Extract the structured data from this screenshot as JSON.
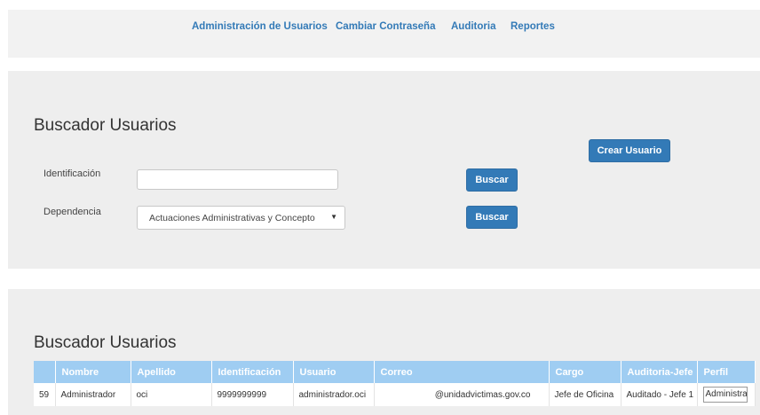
{
  "nav": {
    "items": [
      "Administración de Usuarios",
      "Cambiar Contraseña",
      "Auditoria",
      "Reportes"
    ]
  },
  "search_panel": {
    "title": "Buscador Usuarios",
    "create_button": "Crear Usuario",
    "identificacion_label": "Identificación",
    "identificacion_value": "",
    "dependencia_label": "Dependencia",
    "dependencia_selected": "Actuaciones Administrativas y Concepto",
    "search_button_1": "Buscar",
    "search_button_2": "Buscar"
  },
  "results_panel": {
    "title": "Buscador Usuarios",
    "columns": [
      "",
      "Nombre",
      "Apellido",
      "Identificación",
      "Usuario",
      "Correo",
      "Cargo",
      "Auditoria-Jefe",
      "Perfil"
    ],
    "rows": [
      {
        "id": "59",
        "nombre": "Administrador",
        "apellido": "oci",
        "identificacion": "9999999999",
        "usuario": "administrador.oci",
        "correo": "@unidadvictimas.gov.co",
        "cargo": "Jefe de Oficina",
        "auditoria_jefe": "Auditado - Jefe 1",
        "perfil": "Administrador"
      }
    ]
  },
  "colors": {
    "accent": "#337ab7",
    "table_header": "#9fcdf2",
    "panel_bg": "#eeeeee"
  }
}
